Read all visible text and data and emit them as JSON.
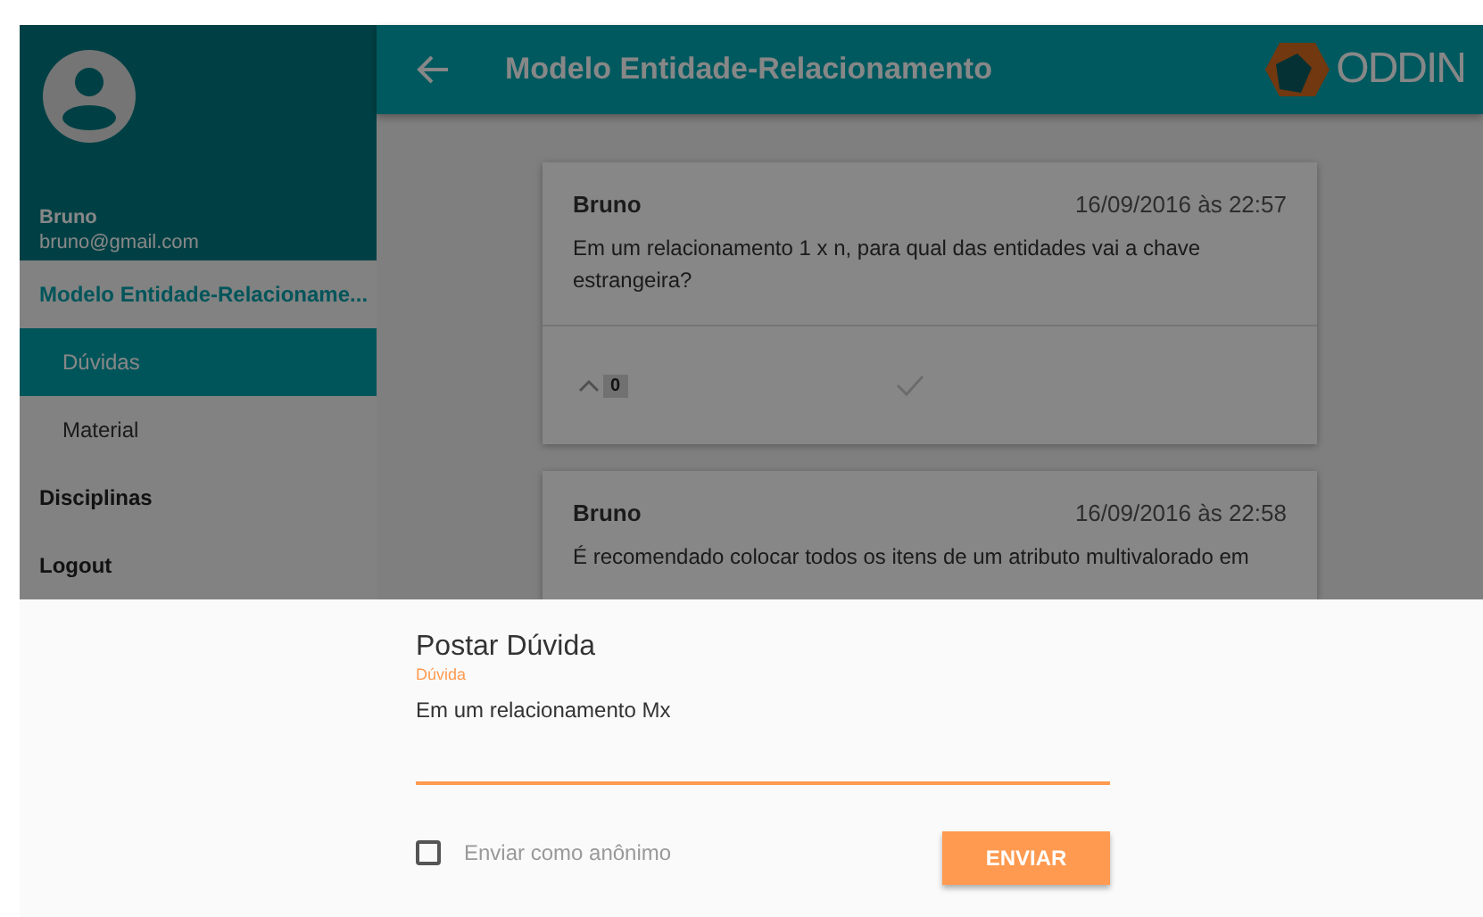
{
  "user": {
    "name": "Bruno",
    "email": "bruno@gmail.com"
  },
  "sidebar": {
    "items": [
      {
        "label": "Modelo Entidade-Relacioname...",
        "expanded": true,
        "children": [
          {
            "label": "Dúvidas",
            "selected": true
          },
          {
            "label": "Material",
            "selected": false
          }
        ]
      },
      {
        "label": "Disciplinas",
        "expanded": false
      },
      {
        "label": "Logout",
        "expanded": false
      }
    ]
  },
  "header": {
    "title": "Modelo Entidade-Relacionamento",
    "logo": "ODDIN"
  },
  "questions": [
    {
      "author": "Bruno",
      "date": "16/09/2016 às 22:57",
      "text": "Em um relacionamento 1 x n, para qual das entidades vai a chave estrangeira?",
      "votes": "0"
    },
    {
      "author": "Bruno",
      "date": "16/09/2016 às 22:58",
      "text": "É recomendado colocar todos os itens de um atributo multivalorado em"
    }
  ],
  "sheet": {
    "title": "Postar Dúvida",
    "field": {
      "label": "Dúvida",
      "value": "Em um relacionamento Mx",
      "focused": true
    },
    "anonymous": {
      "label": "Enviar como anônimo",
      "checked": false
    },
    "submit": "ENVIAR"
  }
}
